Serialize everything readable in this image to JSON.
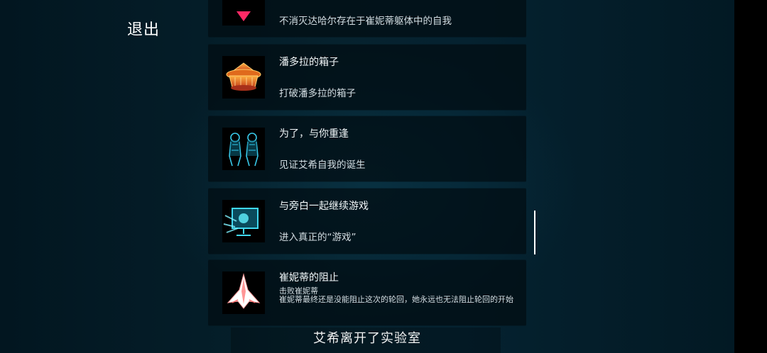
{
  "exit_label": "退出",
  "achievements": [
    {
      "title": "",
      "desc": "不消灭达哈尔存在于崔妮蒂躯体中的自我",
      "icon": "red-heart-icon"
    },
    {
      "title": "潘多拉的箱子",
      "desc": "打破潘多拉的箱子",
      "icon": "pandora-box-icon"
    },
    {
      "title": "为了，与你重逢",
      "desc": "见证艾希自我的诞生",
      "icon": "twin-figures-icon"
    },
    {
      "title": "与旁白一起继续游戏",
      "desc": "进入真正的“游戏”",
      "icon": "monitor-icon"
    },
    {
      "title": "崔妮蒂的阻止",
      "desc_line1": "击败崔妮蒂",
      "desc_line2": "崔妮蒂最终还是没能阻止这次的轮回，她永远也无法阻止轮回的开始",
      "icon": "spaceship-icon"
    }
  ],
  "subtitle": "艾希离开了实验室",
  "colors": {
    "background": "#031a24",
    "card": "#02121a",
    "text": "#f2f6f8"
  }
}
